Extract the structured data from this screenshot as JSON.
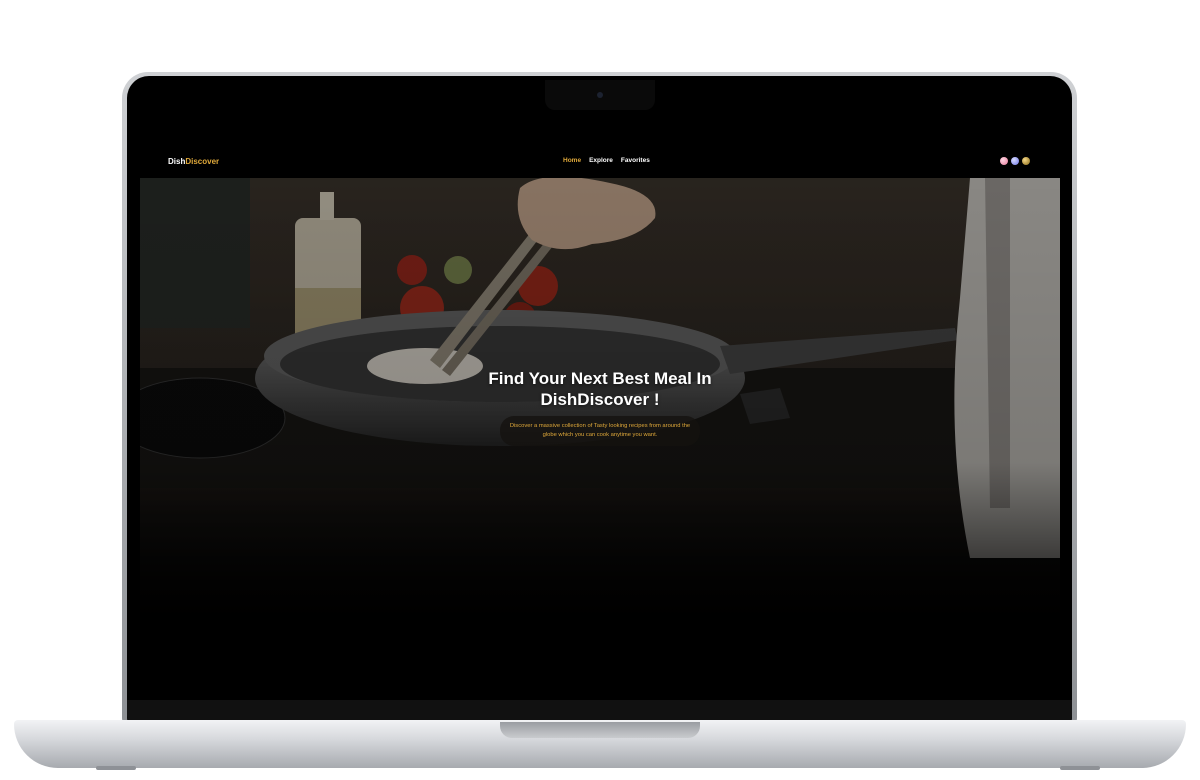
{
  "site": {
    "logo_part1": "Dish",
    "logo_part2": "Discover"
  },
  "nav": {
    "items": [
      {
        "label": "Home",
        "active": true
      },
      {
        "label": "Explore",
        "active": false
      },
      {
        "label": "Favorites",
        "active": false
      }
    ]
  },
  "theme_switcher": {
    "colors": [
      "#e87b9c",
      "#6f76e6",
      "#8a6a14"
    ]
  },
  "hero": {
    "title": "Find Your Next Best Meal In DishDiscover !",
    "subtitle": "Discover a massive collection of Tasty looking recipes from around the globe which you can cook anytime you want."
  },
  "colors": {
    "accent": "#e0a93a",
    "nav_background": "#000000"
  }
}
